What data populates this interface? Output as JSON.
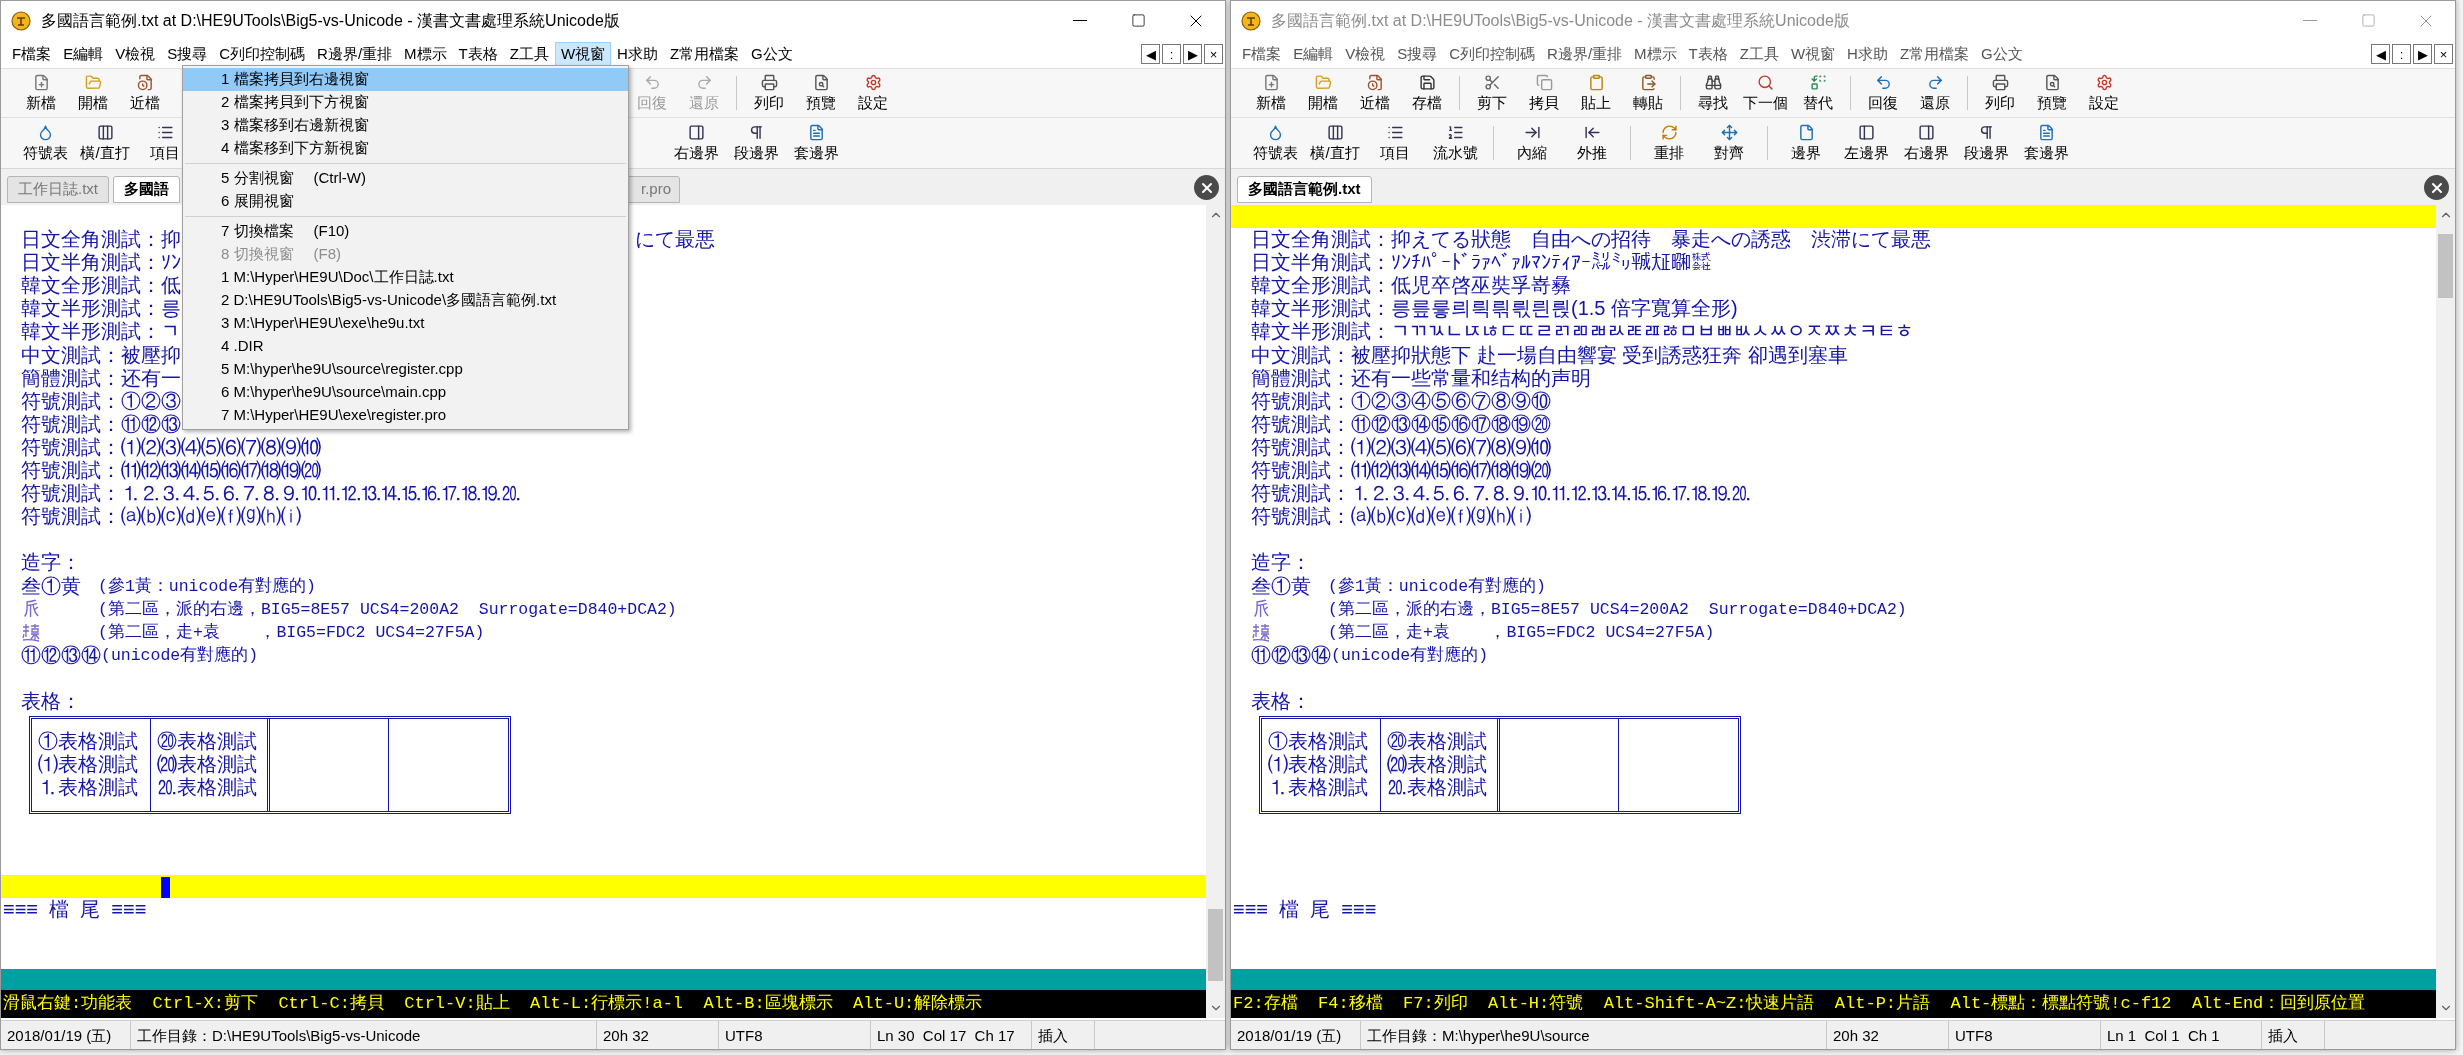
{
  "windows": [
    {
      "active": true,
      "title": "多國語言範例.txt at D:\\HE9UTools\\Big5-vs-Unicode - 漢書文書處理系統Unicode版",
      "menu": [
        {
          "label": "F檔案",
          "selected": false
        },
        {
          "label": "E編輯",
          "selected": false
        },
        {
          "label": "V檢視",
          "selected": false
        },
        {
          "label": "S搜尋",
          "selected": false
        },
        {
          "label": "C列印控制碼",
          "selected": false
        },
        {
          "label": "R邊界/重排",
          "selected": false
        },
        {
          "label": "M標示",
          "selected": false
        },
        {
          "label": "T表格",
          "selected": false
        },
        {
          "label": "Z工具",
          "selected": false
        },
        {
          "label": "W視窗",
          "selected": true
        },
        {
          "label": "H求助",
          "selected": false
        },
        {
          "label": "Z常用檔案",
          "selected": false
        },
        {
          "label": "G公文",
          "selected": false
        }
      ],
      "mdi_controls": [
        "◀",
        ":",
        "▶",
        "×"
      ],
      "toolbar_1": [
        {
          "kind": "button",
          "label": "新檔",
          "disabled": false
        },
        {
          "kind": "button",
          "label": "開檔",
          "disabled": false
        },
        {
          "kind": "button",
          "label": "近檔",
          "disabled": false
        },
        {
          "kind": "covered"
        },
        {
          "kind": "separator"
        },
        {
          "kind": "covered"
        },
        {
          "kind": "covered"
        },
        {
          "kind": "covered"
        },
        {
          "kind": "covered"
        },
        {
          "kind": "separator"
        },
        {
          "kind": "covered"
        },
        {
          "kind": "covered"
        },
        {
          "kind": "covered"
        },
        {
          "kind": "separator"
        },
        {
          "kind": "button",
          "label": "回復",
          "disabled": true
        },
        {
          "kind": "button",
          "label": "還原",
          "disabled": true
        },
        {
          "kind": "separator"
        },
        {
          "kind": "button",
          "label": "列印",
          "disabled": false
        },
        {
          "kind": "button",
          "label": "預覽",
          "disabled": false
        },
        {
          "kind": "button",
          "label": "設定",
          "disabled": false
        }
      ],
      "toolbar_2": [
        {
          "kind": "button",
          "label": "符號表",
          "disabled": false
        },
        {
          "kind": "button",
          "label": "橫/直打",
          "disabled": false
        },
        {
          "kind": "button",
          "label": "項目",
          "disabled": false
        },
        {
          "kind": "covered"
        },
        {
          "kind": "separator"
        },
        {
          "kind": "covered"
        },
        {
          "kind": "covered"
        },
        {
          "kind": "separator"
        },
        {
          "kind": "covered"
        },
        {
          "kind": "covered"
        },
        {
          "kind": "separator"
        },
        {
          "kind": "covered"
        },
        {
          "kind": "covered"
        },
        {
          "kind": "button",
          "label": "右邊界",
          "disabled": false
        },
        {
          "kind": "button",
          "label": "段邊界",
          "disabled": false
        },
        {
          "kind": "button",
          "label": "套邊界",
          "disabled": false
        }
      ],
      "tabs": [
        {
          "kind": "tab",
          "label": "工作日誌.txt",
          "selected": false
        },
        {
          "kind": "tab",
          "label": "多國語",
          "selected": true
        },
        {
          "kind": "covered"
        },
        {
          "kind": "tab",
          "label": "r.pro",
          "selected": false
        }
      ],
      "dropdown_menu": [
        {
          "kind": "item",
          "label": "1 檔案拷貝到右邊視窗",
          "selected": true,
          "disabled": false
        },
        {
          "kind": "item",
          "label": "2 檔案拷貝到下方視窗",
          "selected": false,
          "disabled": false
        },
        {
          "kind": "item",
          "label": "3 檔案移到右邊新視窗",
          "selected": false,
          "disabled": false
        },
        {
          "kind": "item",
          "label": "4 檔案移到下方新視窗",
          "selected": false,
          "disabled": false
        },
        {
          "kind": "separator"
        },
        {
          "kind": "item",
          "label": "5 分割視窗",
          "shortcut": "(Ctrl-W)",
          "selected": false,
          "disabled": false
        },
        {
          "kind": "item",
          "label": "6 展開視窗",
          "selected": false,
          "disabled": false
        },
        {
          "kind": "separator"
        },
        {
          "kind": "item",
          "label": "7 切換檔案",
          "shortcut": "(F10)",
          "selected": false,
          "disabled": false
        },
        {
          "kind": "item",
          "label": "8 切換視窗",
          "shortcut": "(F8)",
          "selected": false,
          "disabled": true
        },
        {
          "kind": "item",
          "label": "1 M:\\Hyper\\HE9U\\Doc\\工作日誌.txt",
          "selected": false,
          "disabled": false
        },
        {
          "kind": "item",
          "label": "2 D:\\HE9UTools\\Big5-vs-Unicode\\多國語言範例.txt",
          "selected": false,
          "disabled": false
        },
        {
          "kind": "item",
          "label": "3 M:\\Hyper\\HE9U\\exe\\he9u.txt",
          "selected": false,
          "disabled": false
        },
        {
          "kind": "item",
          "label": "4 .DIR",
          "selected": false,
          "disabled": false
        },
        {
          "kind": "item",
          "label": "5 M:\\hyper\\he9U\\source\\register.cpp",
          "selected": false,
          "disabled": false
        },
        {
          "kind": "item",
          "label": "6 M:\\hyper\\he9U\\source\\main.cpp",
          "selected": false,
          "disabled": false
        },
        {
          "kind": "item",
          "label": "7 M:\\Hyper\\HE9U\\exe\\register.pro",
          "selected": false,
          "disabled": false
        }
      ],
      "document": [
        {
          "kind": "blank",
          "current": false
        },
        {
          "kind": "text",
          "text": "日文全角測試：抑",
          "tail": "にて最悪"
        },
        {
          "kind": "text",
          "text": "日文半角測試：ｿﾝ"
        },
        {
          "kind": "text",
          "text": "韓文全形測試：低"
        },
        {
          "kind": "text",
          "text": "韓文半形測試：릉"
        },
        {
          "kind": "text",
          "text": "韓文半形測試：ﾡ"
        },
        {
          "kind": "text",
          "text": "中文測試：被壓抑"
        },
        {
          "kind": "text",
          "text": "簡體測試：还有一"
        },
        {
          "kind": "text",
          "text": "符號測試：①②③"
        },
        {
          "kind": "text",
          "text": "符號測試：⑪⑫⑬"
        },
        {
          "kind": "text",
          "text": "符號測試：⑴⑵⑶⑷⑸⑹⑺⑻⑼⑽"
        },
        {
          "kind": "text",
          "text": "符號測試：⑾⑿⒀⒁⒂⒃⒄⒅⒆⒇"
        },
        {
          "kind": "text",
          "text": "符號測試：⒈⒉⒊⒋⒌⒍⒎⒏⒐⒑⒒⒓⒔⒕⒖⒗⒘⒙⒚⒛"
        },
        {
          "kind": "text",
          "text": "符號測試：⒜⒝⒞⒟⒠⒡⒢⒣⒤"
        },
        {
          "kind": "blank",
          "current": false
        },
        {
          "kind": "text",
          "text": "造字："
        },
        {
          "kind": "glyph",
          "glyph": "叁①黄",
          "color": "#1414a8",
          "note": "(參1黃：unicode有對應的)"
        },
        {
          "kind": "glyph",
          "glyph": "𠂢",
          "color": "#7a6ad0",
          "note": "(第二區，派的右邊，BIG5=8E57 UCS4=200A2  Surrogate=D840+DCA2)"
        },
        {
          "kind": "glyph_icon",
          "color": "#7a6ad0",
          "note": "(第二區，走+袁    ，BIG5=FDC2 UCS4=27F5A)"
        },
        {
          "kind": "mark_note",
          "glyph": "⑪⑫⑬⑭",
          "note": "(unicode有對應的)"
        },
        {
          "kind": "blank",
          "current": false
        },
        {
          "kind": "text",
          "text": "表格："
        },
        {
          "kind": "table",
          "rows": [
            [
              "①表格測試",
              "⑳表格測試"
            ],
            [
              "⑴表格測試",
              "⒇表格測試"
            ],
            [
              "⒈表格測試",
              "⒛表格測試"
            ]
          ]
        },
        {
          "kind": "blank",
          "current": false
        },
        {
          "kind": "blank",
          "current": false
        },
        {
          "kind": "blank",
          "current": true
        },
        {
          "kind": "eof",
          "text": "≡≡≡  檔  尾  ≡≡≡"
        }
      ],
      "hint_bar": "滑鼠右鍵:功能表  Ctrl-X:剪下  Ctrl-C:拷貝  Ctrl-V:貼上  Alt-L:行標示!a-l  Alt-B:區塊標示  Alt-U:解除標示",
      "status_bar": [
        "2018/01/19 (五)",
        "工作目錄：D:\\HE9UTools\\Big5-vs-Unicode",
        "20h 32",
        "UTF8",
        "Ln 30  Col 17  Ch 17",
        "插入"
      ]
    },
    {
      "active": false,
      "title": "多國語言範例.txt at D:\\HE9UTools\\Big5-vs-Unicode - 漢書文書處理系統Unicode版",
      "menu": [
        {
          "label": "F檔案",
          "selected": false
        },
        {
          "label": "E編輯",
          "selected": false
        },
        {
          "label": "V檢視",
          "selected": false
        },
        {
          "label": "S搜尋",
          "selected": false
        },
        {
          "label": "C列印控制碼",
          "selected": false
        },
        {
          "label": "R邊界/重排",
          "selected": false
        },
        {
          "label": "M標示",
          "selected": false
        },
        {
          "label": "T表格",
          "selected": false
        },
        {
          "label": "Z工具",
          "selected": false
        },
        {
          "label": "W視窗",
          "selected": false
        },
        {
          "label": "H求助",
          "selected": false
        },
        {
          "label": "Z常用檔案",
          "selected": false
        },
        {
          "label": "G公文",
          "selected": false
        }
      ],
      "mdi_controls": [
        "◀",
        ":",
        "▶",
        "×"
      ],
      "toolbar_1": [
        {
          "kind": "button",
          "label": "新檔",
          "disabled": false
        },
        {
          "kind": "button",
          "label": "開檔",
          "disabled": false
        },
        {
          "kind": "button",
          "label": "近檔",
          "disabled": false
        },
        {
          "kind": "button",
          "label": "存檔",
          "disabled": false
        },
        {
          "kind": "separator"
        },
        {
          "kind": "button",
          "label": "剪下",
          "disabled": false
        },
        {
          "kind": "button",
          "label": "拷貝",
          "disabled": false
        },
        {
          "kind": "button",
          "label": "貼上",
          "disabled": false
        },
        {
          "kind": "button",
          "label": "轉貼",
          "disabled": false
        },
        {
          "kind": "separator"
        },
        {
          "kind": "button",
          "label": "尋找",
          "disabled": false
        },
        {
          "kind": "button",
          "label": "下一個",
          "disabled": false
        },
        {
          "kind": "button",
          "label": "替代",
          "disabled": false
        },
        {
          "kind": "separator"
        },
        {
          "kind": "button",
          "label": "回復",
          "disabled": false
        },
        {
          "kind": "button",
          "label": "還原",
          "disabled": false
        },
        {
          "kind": "separator"
        },
        {
          "kind": "button",
          "label": "列印",
          "disabled": false
        },
        {
          "kind": "button",
          "label": "預覽",
          "disabled": false
        },
        {
          "kind": "button",
          "label": "設定",
          "disabled": false
        }
      ],
      "toolbar_2": [
        {
          "kind": "button",
          "label": "符號表",
          "disabled": false
        },
        {
          "kind": "button",
          "label": "橫/直打",
          "disabled": false
        },
        {
          "kind": "button",
          "label": "項目",
          "disabled": false
        },
        {
          "kind": "button",
          "label": "流水號",
          "disabled": false
        },
        {
          "kind": "separator"
        },
        {
          "kind": "button",
          "label": "內縮",
          "disabled": false
        },
        {
          "kind": "button",
          "label": "外推",
          "disabled": false
        },
        {
          "kind": "separator"
        },
        {
          "kind": "button",
          "label": "重排",
          "disabled": false
        },
        {
          "kind": "button",
          "label": "對齊",
          "disabled": false
        },
        {
          "kind": "separator"
        },
        {
          "kind": "button",
          "label": "邊界",
          "disabled": false
        },
        {
          "kind": "button",
          "label": "左邊界",
          "disabled": false
        },
        {
          "kind": "button",
          "label": "右邊界",
          "disabled": false
        },
        {
          "kind": "button",
          "label": "段邊界",
          "disabled": false
        },
        {
          "kind": "button",
          "label": "套邊界",
          "disabled": false
        }
      ],
      "tabs": [
        {
          "kind": "tab",
          "label": "多國語言範例.txt",
          "selected": true
        }
      ],
      "document": [
        {
          "kind": "blank",
          "current": true
        },
        {
          "kind": "text",
          "text": "日文全角測試：抑えてる狀態　自由への招待　暴走への誘惑　渋滞にて最悪"
        },
        {
          "kind": "text",
          "text": "日文半角測試：ｿﾝﾁﾊﾟｰﾄﾞﾗｧﾍﾞｧﾙﾏﾝﾃｨｱｰ㍊㍉㍻㍽㍼㍿"
        },
        {
          "kind": "text",
          "text": "韓文全形測試：低児卒啓巫奘孚嵜彝"
        },
        {
          "kind": "text",
          "text": "韓文半形測試：릉릎릏릐릑릒릓릔릕(1.5 倍字寬算全形)"
        },
        {
          "kind": "text",
          "text": "韓文半形測試：ﾡﾢﾣﾤﾥﾦﾧﾨﾩﾪﾫﾬﾭﾮﾯﾰﾱﾲﾳﾴﾵﾶﾷﾸﾹﾺﾻﾼﾾ"
        },
        {
          "kind": "text",
          "text": "中文測試：被壓抑狀態下 赴一場自由響宴 受到誘惑狂奔 卻遇到塞車"
        },
        {
          "kind": "text",
          "text": "簡體測試：还有一些常量和结构的声明"
        },
        {
          "kind": "text",
          "text": "符號測試：①②③④⑤⑥⑦⑧⑨⑩"
        },
        {
          "kind": "text",
          "text": "符號測試：⑪⑫⑬⑭⑮⑯⑰⑱⑲⑳"
        },
        {
          "kind": "text",
          "text": "符號測試：⑴⑵⑶⑷⑸⑹⑺⑻⑼⑽"
        },
        {
          "kind": "text",
          "text": "符號測試：⑾⑿⒀⒁⒂⒃⒄⒅⒆⒇"
        },
        {
          "kind": "text",
          "text": "符號測試：⒈⒉⒊⒋⒌⒍⒎⒏⒐⒑⒒⒓⒔⒕⒖⒗⒘⒙⒚⒛"
        },
        {
          "kind": "text",
          "text": "符號測試：⒜⒝⒞⒟⒠⒡⒢⒣⒤"
        },
        {
          "kind": "blank",
          "current": false
        },
        {
          "kind": "text",
          "text": "造字："
        },
        {
          "kind": "glyph",
          "glyph": "叁①黄",
          "color": "#1414a8",
          "note": "(參1黃：unicode有對應的)"
        },
        {
          "kind": "glyph",
          "glyph": "𠂢",
          "color": "#7a6ad0",
          "note": "(第二區，派的右邊，BIG5=8E57 UCS4=200A2  Surrogate=D840+DCA2)"
        },
        {
          "kind": "glyph_icon",
          "color": "#7a6ad0",
          "note": "(第二區，走+袁    ，BIG5=FDC2 UCS4=27F5A)"
        },
        {
          "kind": "mark_note",
          "glyph": "⑪⑫⑬⑭",
          "note": "(unicode有對應的)"
        },
        {
          "kind": "blank",
          "current": false
        },
        {
          "kind": "text",
          "text": "表格："
        },
        {
          "kind": "table",
          "rows": [
            [
              "①表格測試",
              "⑳表格測試"
            ],
            [
              "⑴表格測試",
              "⒇表格測試"
            ],
            [
              "⒈表格測試",
              "⒛表格測試"
            ]
          ]
        },
        {
          "kind": "blank",
          "current": false
        },
        {
          "kind": "blank",
          "current": false
        },
        {
          "kind": "blank",
          "current": false
        },
        {
          "kind": "eof",
          "text": "≡≡≡  檔  尾  ≡≡≡"
        }
      ],
      "hint_bar": "F2:存檔  F4:移檔  F7:列印  Alt-H:符號  Alt-Shift-A~Z:快速片語  Alt-P:片語  Alt-標點：標點符號!c-f12  Alt-End：回到原位置",
      "status_bar": [
        "2018/01/19 (五)",
        "工作目錄：M:\\hyper\\he9U\\source",
        "20h 32",
        "UTF8",
        "Ln 1  Col 1  Ch 1",
        "插入"
      ]
    }
  ]
}
